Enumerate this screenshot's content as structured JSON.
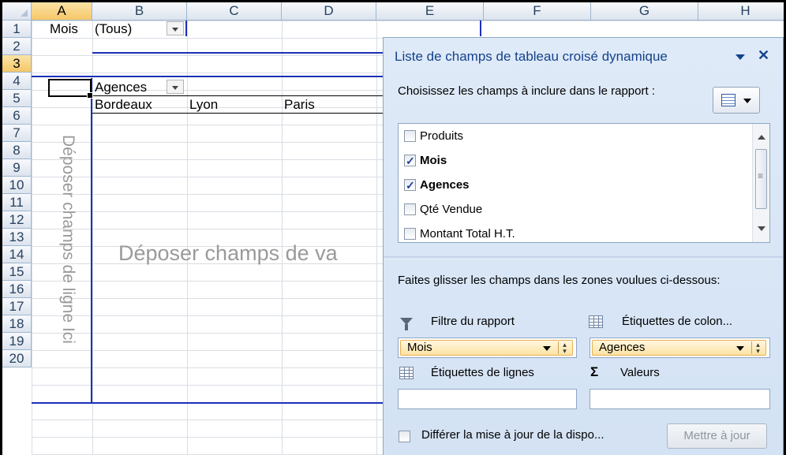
{
  "columns": [
    "A",
    "B",
    "C",
    "D",
    "E",
    "F",
    "G",
    "H"
  ],
  "rows": [
    "1",
    "2",
    "3",
    "4",
    "5",
    "6",
    "7",
    "8",
    "9",
    "10",
    "11",
    "12",
    "13",
    "14",
    "15",
    "16",
    "17",
    "18",
    "19",
    "20"
  ],
  "pivot": {
    "filter_label": "Mois",
    "filter_value": "(Tous)",
    "column_header": "Agences",
    "column_items": [
      "Bordeaux",
      "Lyon",
      "Paris"
    ],
    "drop_rows_hint": "Déposer champs de ligne Ici",
    "drop_values_hint": "Déposer champs de va"
  },
  "panel": {
    "title": "Liste de champs de tableau croisé dynamique",
    "choose_text": "Choisissez les champs à inclure dans le rapport :",
    "fields": [
      {
        "label": "Produits",
        "checked": false
      },
      {
        "label": "Mois",
        "checked": true
      },
      {
        "label": "Agences",
        "checked": true
      },
      {
        "label": "Qté Vendue",
        "checked": false
      },
      {
        "label": "Montant Total H.T.",
        "checked": false
      }
    ],
    "drag_text": "Faites glisser les champs dans les zones voulues ci-dessous:",
    "zones": {
      "report_filter": {
        "label": "Filtre du rapport",
        "item": "Mois"
      },
      "column_labels": {
        "label": "Étiquettes de colon...",
        "item": "Agences"
      },
      "row_labels": {
        "label": "Étiquettes de lignes"
      },
      "values": {
        "label": "Valeurs"
      }
    },
    "defer_label": "Différer la mise à jour de la dispo...",
    "update_button": "Mettre à jour"
  },
  "icons": {
    "filter": "filter-icon",
    "grid": "table-grid-icon",
    "sigma": "sigma-icon"
  },
  "colors": {
    "pivot_border": "#1c2fb8",
    "panel_background": "#dfeaf8",
    "panel_title": "#15428b"
  }
}
